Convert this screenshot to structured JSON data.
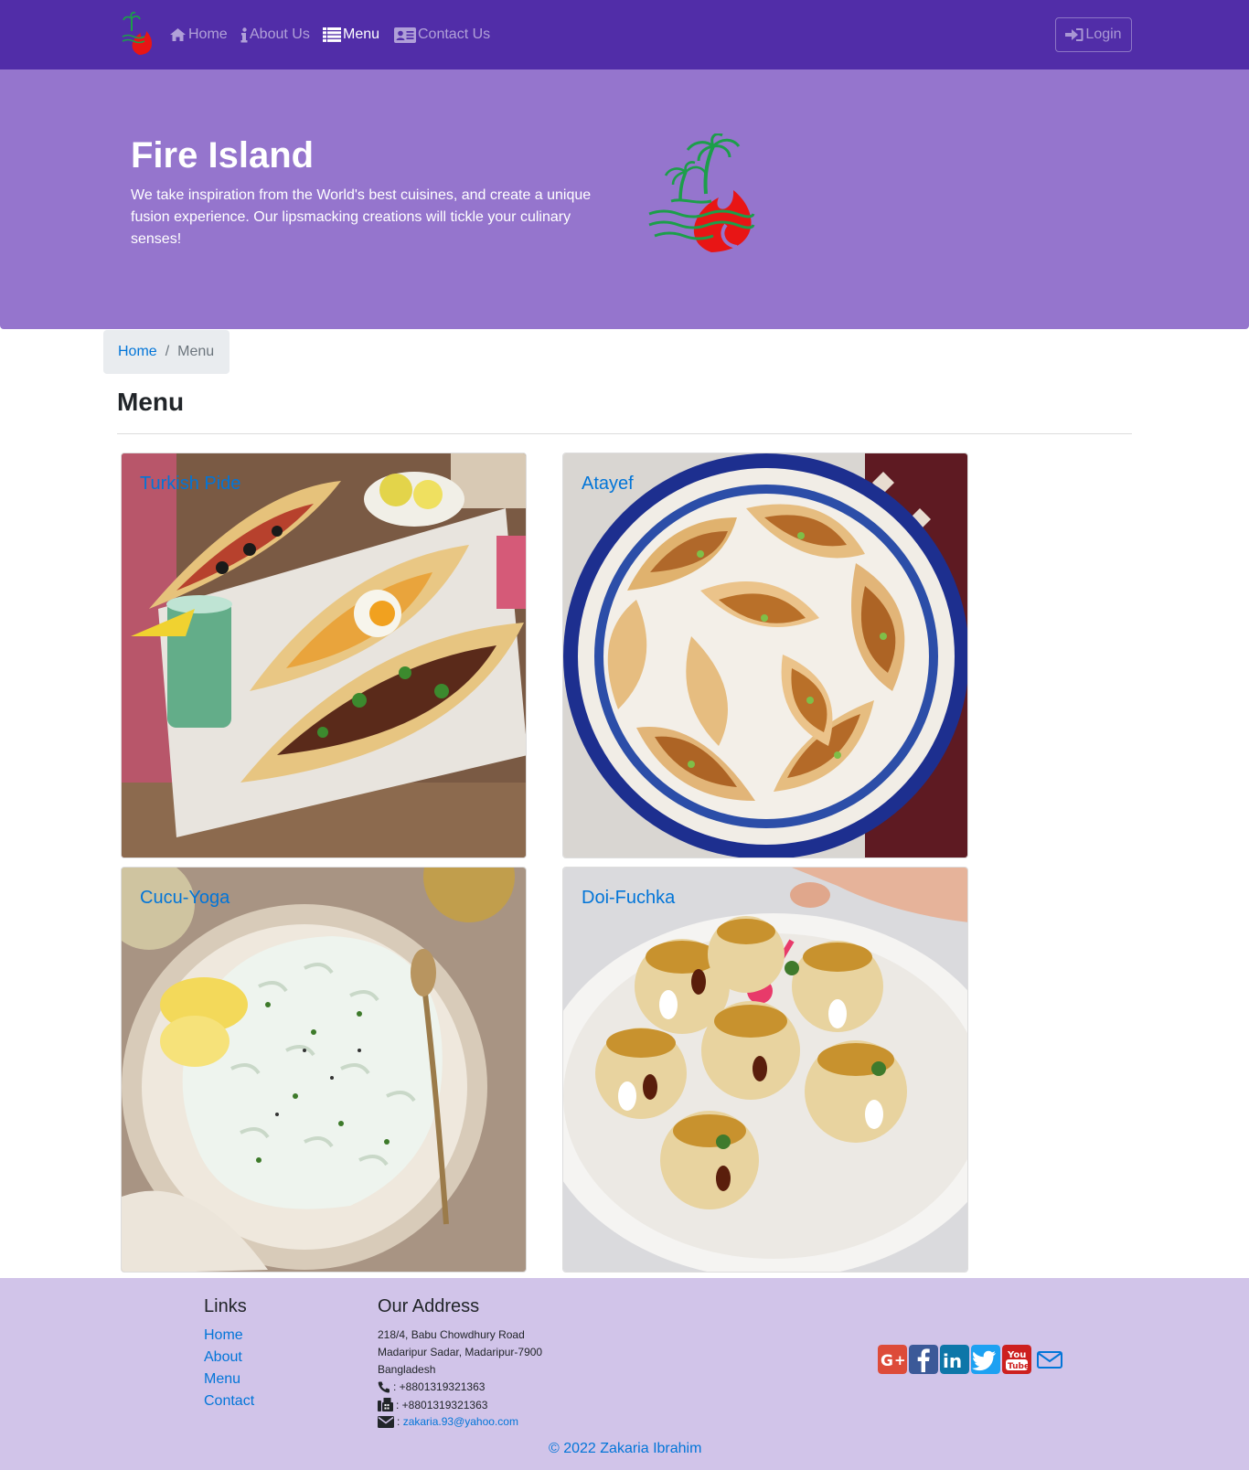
{
  "nav": {
    "items": [
      {
        "label": "Home",
        "icon": "home-icon"
      },
      {
        "label": "About Us",
        "icon": "info-icon"
      },
      {
        "label": "Menu",
        "icon": "list-icon"
      },
      {
        "label": "Contact Us",
        "icon": "address-card-icon"
      }
    ],
    "login_label": "Login",
    "active_item": "Menu"
  },
  "hero": {
    "title": "Fire Island",
    "text": "We take inspiration from the World's best cuisines, and create a unique fusion experience. Our lipsmacking creations will tickle your culinary senses!"
  },
  "breadcrumb": {
    "home": "Home",
    "separator": "/",
    "current": "Menu"
  },
  "page": {
    "heading": "Menu"
  },
  "dishes": [
    {
      "name": "Turkish Pide"
    },
    {
      "name": "Atayef"
    },
    {
      "name": "Cucu-Yoga"
    },
    {
      "name": "Doi-Fuchka"
    }
  ],
  "footer": {
    "links_heading": "Links",
    "links": [
      "Home",
      "About",
      "Menu",
      "Contact"
    ],
    "address_heading": "Our Address",
    "address": [
      "218/4, Babu Chowdhury Road",
      "Madaripur Sadar, Madaripur-7900",
      "Bangladesh"
    ],
    "phone": ": +8801319321363",
    "fax": ": +8801319321363",
    "email_prefix": ":",
    "email": "zakaria.93@yahoo.com",
    "copyright": "© 2022 Zakaria Ibrahim",
    "social": [
      "google-plus-icon",
      "facebook-icon",
      "linkedin-icon",
      "twitter-icon",
      "youtube-icon",
      "envelope-icon"
    ]
  },
  "colors": {
    "navbar": "#512da8",
    "jumbotron": "#9575cd",
    "footer": "#d1c4e9",
    "link": "#0275d8"
  }
}
